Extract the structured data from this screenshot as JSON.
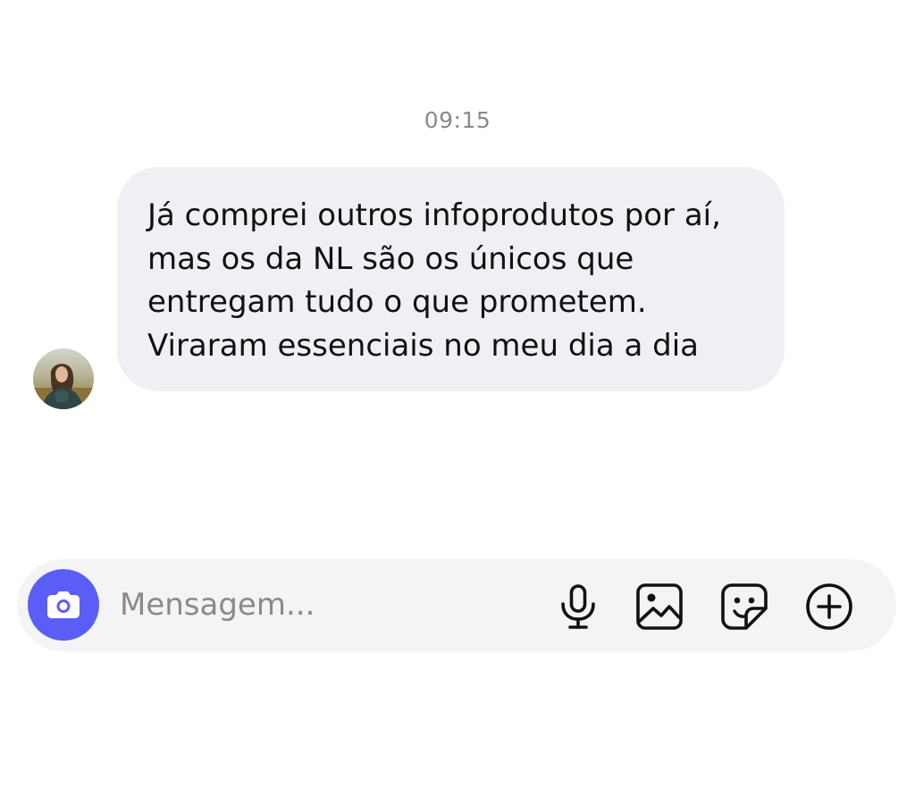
{
  "chat": {
    "timestamp": "09:15",
    "message": {
      "lines": [
        "Já comprei outros infoprodutos por aí,",
        "mas os da NL são os únicos que",
        "entregam tudo o que prometem.",
        "Viraram essenciais no meu dia a dia"
      ]
    }
  },
  "composer": {
    "placeholder": "Mensagem...",
    "value": "",
    "icons": {
      "camera": "camera-icon",
      "microphone": "microphone-icon",
      "gallery": "gallery-icon",
      "sticker": "sticker-icon",
      "add": "plus-circle-icon"
    }
  },
  "colors": {
    "accent": "#5b5ef6",
    "bubble": "#eff0f4",
    "composer_bg": "#f4f4f5",
    "timestamp": "#8a8a8e"
  }
}
